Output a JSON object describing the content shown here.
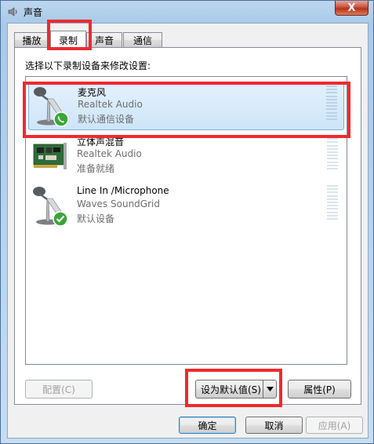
{
  "window": {
    "title": "声音",
    "close_label": "X"
  },
  "tabs": [
    {
      "label": "播放",
      "active": false
    },
    {
      "label": "录制",
      "active": true
    },
    {
      "label": "声音",
      "active": false
    },
    {
      "label": "通信",
      "active": false
    }
  ],
  "instruction": "选择以下录制设备来修改设置:",
  "devices": [
    {
      "name": "麦克风",
      "driver": "Realtek Audio",
      "status": "默认通信设备",
      "icon": "microphone-icon",
      "badge": "phone-badge-icon",
      "selected": true
    },
    {
      "name": "立体声混音",
      "driver": "Realtek Audio",
      "status": "准备就绪",
      "icon": "sound-card-icon",
      "selected": false
    },
    {
      "name": "Line In /Microphone",
      "driver": "Waves SoundGrid",
      "status": "默认设备",
      "icon": "microphone-icon",
      "badge": "checkmark-badge-icon",
      "selected": false
    }
  ],
  "buttons": {
    "configure": "配置(C)",
    "set_default": "设为默认值(S)",
    "properties": "属性(P)",
    "ok": "确定",
    "cancel": "取消",
    "apply": "应用(A)"
  },
  "colors": {
    "highlight_box": "#ee2a2f",
    "selection": "#cde5f9",
    "title_bg": "#a9c9e8"
  }
}
